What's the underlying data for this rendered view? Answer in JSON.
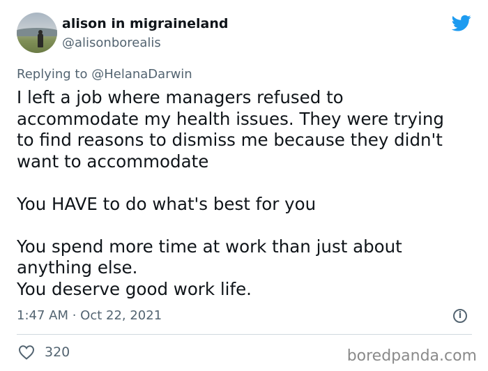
{
  "tweet": {
    "display_name": "alison in migraineland",
    "handle": "@alisonborealis",
    "reply_prefix": "Replying to",
    "reply_to": "@HelanaDarwin",
    "body_lines": [
      "I left a job where managers refused to",
      "accommodate my health issues. They were trying",
      "to find reasons to dismiss me because they didn't",
      "want to accommodate",
      "",
      "You HAVE to do what's best for you",
      "",
      "You spend more time at work than just about",
      "anything else.",
      "You deserve good work life."
    ],
    "timestamp": "1:47 AM · Oct 22, 2021",
    "likes": "320"
  },
  "watermark": "boredpanda.com",
  "icons": {
    "brand": "twitter-bird-icon",
    "info": "info-icon",
    "like": "heart-icon"
  },
  "colors": {
    "twitter_blue": "#1d9bf0",
    "text": "#0f1419",
    "secondary": "#536471",
    "divider": "#cfd9de"
  }
}
